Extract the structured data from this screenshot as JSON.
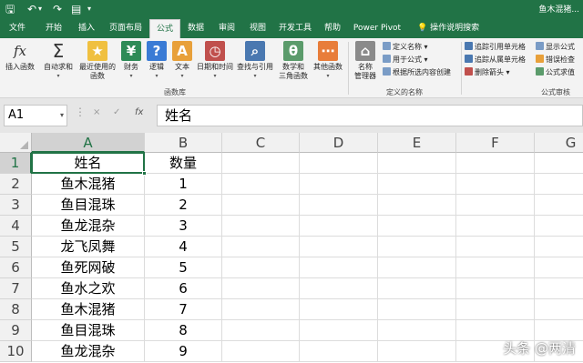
{
  "titlebar": {
    "title": "鱼木混猪...",
    "save_icon": "save-icon",
    "undo_icon": "undo-icon",
    "redo_icon": "redo-icon",
    "form_icon": "form-icon",
    "customize_icon": "dropdown-icon"
  },
  "tabs": [
    "文件",
    "开始",
    "插入",
    "页面布局",
    "公式",
    "数据",
    "审阅",
    "视图",
    "开发工具",
    "帮助",
    "Power Pivot"
  ],
  "active_tab": "公式",
  "tell_me": "操作说明搜索",
  "ribbon": {
    "function_library": {
      "label": "函数库",
      "insert_function": "插入函数",
      "insert_function_glyph": "fx",
      "autosum": "自动求和",
      "autosum_glyph": "Σ",
      "recent": "最近使用的",
      "recent_2": "函数",
      "financial": "财务",
      "logical": "逻辑",
      "text": "文本",
      "datetime": "日期和时间",
      "lookup": "查找与引用",
      "math": "数学和",
      "math_2": "三角函数",
      "more": "其他函数"
    },
    "defined_names": {
      "label": "定义的名称",
      "name_manager": "名称",
      "name_manager_2": "管理器",
      "define_name": "定义名称",
      "use_in_formula": "用于公式",
      "create_from_selection": "根据所选内容创建"
    },
    "formula_auditing": {
      "label": "公式审核",
      "trace_precedents": "追踪引用单元格",
      "trace_dependents": "追踪从属单元格",
      "remove_arrows": "删除箭头",
      "show_formulas": "显示公式",
      "error_checking": "错误检查",
      "evaluate_formula": "公式求值"
    }
  },
  "formula_bar": {
    "name_box": "A1",
    "cancel": "×",
    "enter": "✓",
    "fx": "fx",
    "content": "姓名"
  },
  "sheet": {
    "columns": [
      "A",
      "B",
      "C",
      "D",
      "E",
      "F",
      "G"
    ],
    "rows": [
      "1",
      "2",
      "3",
      "4",
      "5",
      "6",
      "7",
      "8",
      "9",
      "10"
    ],
    "data": [
      [
        "姓名",
        "数量"
      ],
      [
        "鱼木混猪",
        "1"
      ],
      [
        "鱼目混珠",
        "2"
      ],
      [
        "鱼龙混杂",
        "3"
      ],
      [
        "龙飞凤舞",
        "4"
      ],
      [
        "鱼死网破",
        "5"
      ],
      [
        "鱼水之欢",
        "6"
      ],
      [
        "鱼木混猪",
        "7"
      ],
      [
        "鱼目混珠",
        "8"
      ],
      [
        "鱼龙混杂",
        "9"
      ]
    ],
    "active_cell": "A1"
  },
  "watermark": "头条 @两清",
  "colors": {
    "accent": "#217346",
    "ribbon_bg": "#f3f3f3",
    "header_bg": "#f1f1f1"
  }
}
